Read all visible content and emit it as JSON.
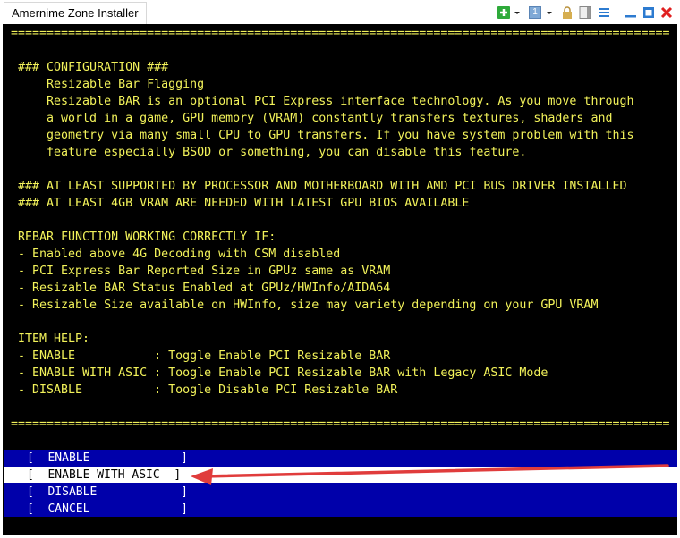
{
  "window": {
    "title": "Amernime Zone Installer"
  },
  "toolbar_icons": [
    "add-icon",
    "dropdown-icon",
    "tab-number-icon",
    "dropdown-icon",
    "lock-icon",
    "panel-icon",
    "menu-icon",
    "minimize-icon",
    "maximize-icon",
    "close-icon"
  ],
  "tab_number": "1",
  "separator": "============================================================================================",
  "lines": [
    "",
    " ### CONFIGURATION ###",
    "     Resizable Bar Flagging",
    "     Resizable BAR is an optional PCI Express interface technology. As you move through",
    "     a world in a game, GPU memory (VRAM) constantly transfers textures, shaders and",
    "     geometry via many small CPU to GPU transfers. If you have system problem with this",
    "     feature especially BSOD or something, you can disable this feature.",
    "",
    " ### AT LEAST SUPPORTED BY PROCESSOR AND MOTHERBOARD WITH AMD PCI BUS DRIVER INSTALLED",
    " ### AT LEAST 4GB VRAM ARE NEEDED WITH LATEST GPU BIOS AVAILABLE",
    "",
    " REBAR FUNCTION WORKING CORRECTLY IF:",
    " - Enabled above 4G Decoding with CSM disabled",
    " - PCI Express Bar Reported Size in GPUz same as VRAM",
    " - Resizable BAR Status Enabled at GPUz/HWInfo/AIDA64",
    " - Resizable Size available on HWInfo, size may variety depending on your GPU VRAM",
    "",
    " ITEM HELP:",
    " - ENABLE           : Toggle Enable PCI Resizable BAR",
    " - ENABLE WITH ASIC : Toogle Enable PCI Resizable BAR with Legacy ASIC Mode",
    " - DISABLE          : Toogle Disable PCI Resizable BAR",
    ""
  ],
  "menu": [
    {
      "label": "[  ENABLE             ]",
      "selected": false
    },
    {
      "label": "[  ENABLE WITH ASIC  ]",
      "selected": true
    },
    {
      "label": "[  DISABLE            ]",
      "selected": false
    },
    {
      "label": "[  CANCEL             ]",
      "selected": false
    }
  ],
  "colors": {
    "text": "#f2f25a",
    "menu_bg": "#0000aa",
    "arrow": "#e03c3c"
  }
}
